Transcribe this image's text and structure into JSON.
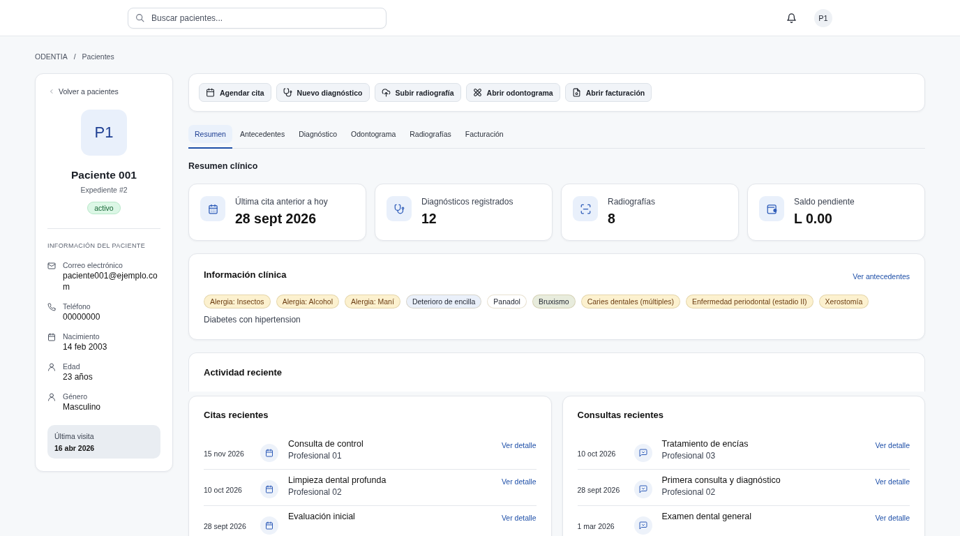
{
  "topbar": {
    "search": {
      "placeholder": "Buscar pacientes..."
    },
    "user_initials": "P1"
  },
  "breadcrumb": {
    "items": [
      "ODENTIA",
      "Pacientes"
    ],
    "separator": "/"
  },
  "patient": {
    "back_link": "Volver a pacientes",
    "initials": "P1",
    "name": "Paciente 001",
    "record": "Expediente #2",
    "status": "activo",
    "section_title": "INFORMACIÓN DEL PACIENTE",
    "fields": [
      {
        "kind": "email",
        "label": "Correo electrónico",
        "value": "paciente001@ejemplo.com"
      },
      {
        "kind": "phone",
        "label": "Teléfono",
        "value": "00000000"
      },
      {
        "kind": "birth",
        "label": "Nacimiento",
        "value": "14 feb 2003"
      },
      {
        "kind": "age",
        "label": "Edad",
        "value": "23 años"
      },
      {
        "kind": "gender",
        "label": "Género",
        "value": "Masculino"
      }
    ],
    "last_visit": {
      "label": "Última visita",
      "value": "16 abr 2026"
    }
  },
  "actions": [
    {
      "kind": "appointment",
      "label": "Agendar cita"
    },
    {
      "kind": "diagnosis",
      "label": "Nuevo diagnóstico"
    },
    {
      "kind": "radiograph",
      "label": "Subir radiografía"
    },
    {
      "kind": "odontogram",
      "label": "Abrir odontograma"
    },
    {
      "kind": "billing",
      "label": "Abrir facturación"
    }
  ],
  "tabs": [
    {
      "label": "Resumen",
      "selected": true
    },
    {
      "label": "Antecedentes",
      "selected": false
    },
    {
      "label": "Diagnóstico",
      "selected": false
    },
    {
      "label": "Odontograma",
      "selected": false
    },
    {
      "label": "Radiografías",
      "selected": false
    },
    {
      "label": "Facturación",
      "selected": false
    }
  ],
  "summary": {
    "title": "Resumen clínico",
    "stats": [
      {
        "kind": "appointment",
        "label": "Última cita anterior a hoy",
        "value": "28 sept 2026"
      },
      {
        "kind": "diagnosis",
        "label": "Diagnósticos registrados",
        "value": "12"
      },
      {
        "kind": "radiograph",
        "label": "Radiografías",
        "value": "8"
      },
      {
        "kind": "balance",
        "label": "Saldo pendiente",
        "value": "L 0.00"
      }
    ]
  },
  "clinical_info": {
    "title": "Información clínica",
    "link": "Ver antecedentes",
    "tags": [
      {
        "label": "Alergia: Insectos",
        "color": "#fcf1cf"
      },
      {
        "label": "Alergia: Alcohol",
        "color": "#fcf1cf"
      },
      {
        "label": "Alergia: Maní",
        "color": "#fcf1cf"
      },
      {
        "label": "Deterioro de encilla",
        "color": "#eaf0fa"
      },
      {
        "label": "Panadol",
        "color": "#ffffff"
      },
      {
        "label": "Bruxismo",
        "color": "#e8ecdd"
      },
      {
        "label": "Caries dentales (múltiples)",
        "color": "#fcf1cf"
      },
      {
        "label": "Enfermedad periodontal (estadio II)",
        "color": "#fcf1cf"
      },
      {
        "label": "Xerostomía",
        "color": "#fcf1cf"
      }
    ],
    "note": "Diabetes con hipertension"
  },
  "activity": {
    "title": "Actividad reciente",
    "panels": [
      {
        "kind": "appointments",
        "title": "Citas recientes",
        "rows": [
          {
            "date": "15 nov 2026",
            "title": "Consulta de control",
            "subtitle": "Profesional 01",
            "link": "Ver detalle"
          },
          {
            "date": "10 oct 2026",
            "title": "Limpieza dental profunda",
            "subtitle": "Profesional 02",
            "link": "Ver detalle"
          },
          {
            "date": "28 sept 2026",
            "title": "Evaluación inicial",
            "link": "Ver detalle"
          }
        ]
      },
      {
        "kind": "consultations",
        "title": "Consultas recientes",
        "rows": [
          {
            "date": "10 oct 2026",
            "title": "Tratamiento de encías",
            "subtitle": "Profesional 03",
            "link": "Ver detalle"
          },
          {
            "date": "28 sept 2026",
            "title": "Primera consulta y diagnóstico",
            "subtitle": "Profesional 02",
            "link": "Ver detalle"
          },
          {
            "date": "1 mar 2026",
            "title": "Examen dental general",
            "link": "Ver detalle"
          }
        ]
      }
    ]
  }
}
